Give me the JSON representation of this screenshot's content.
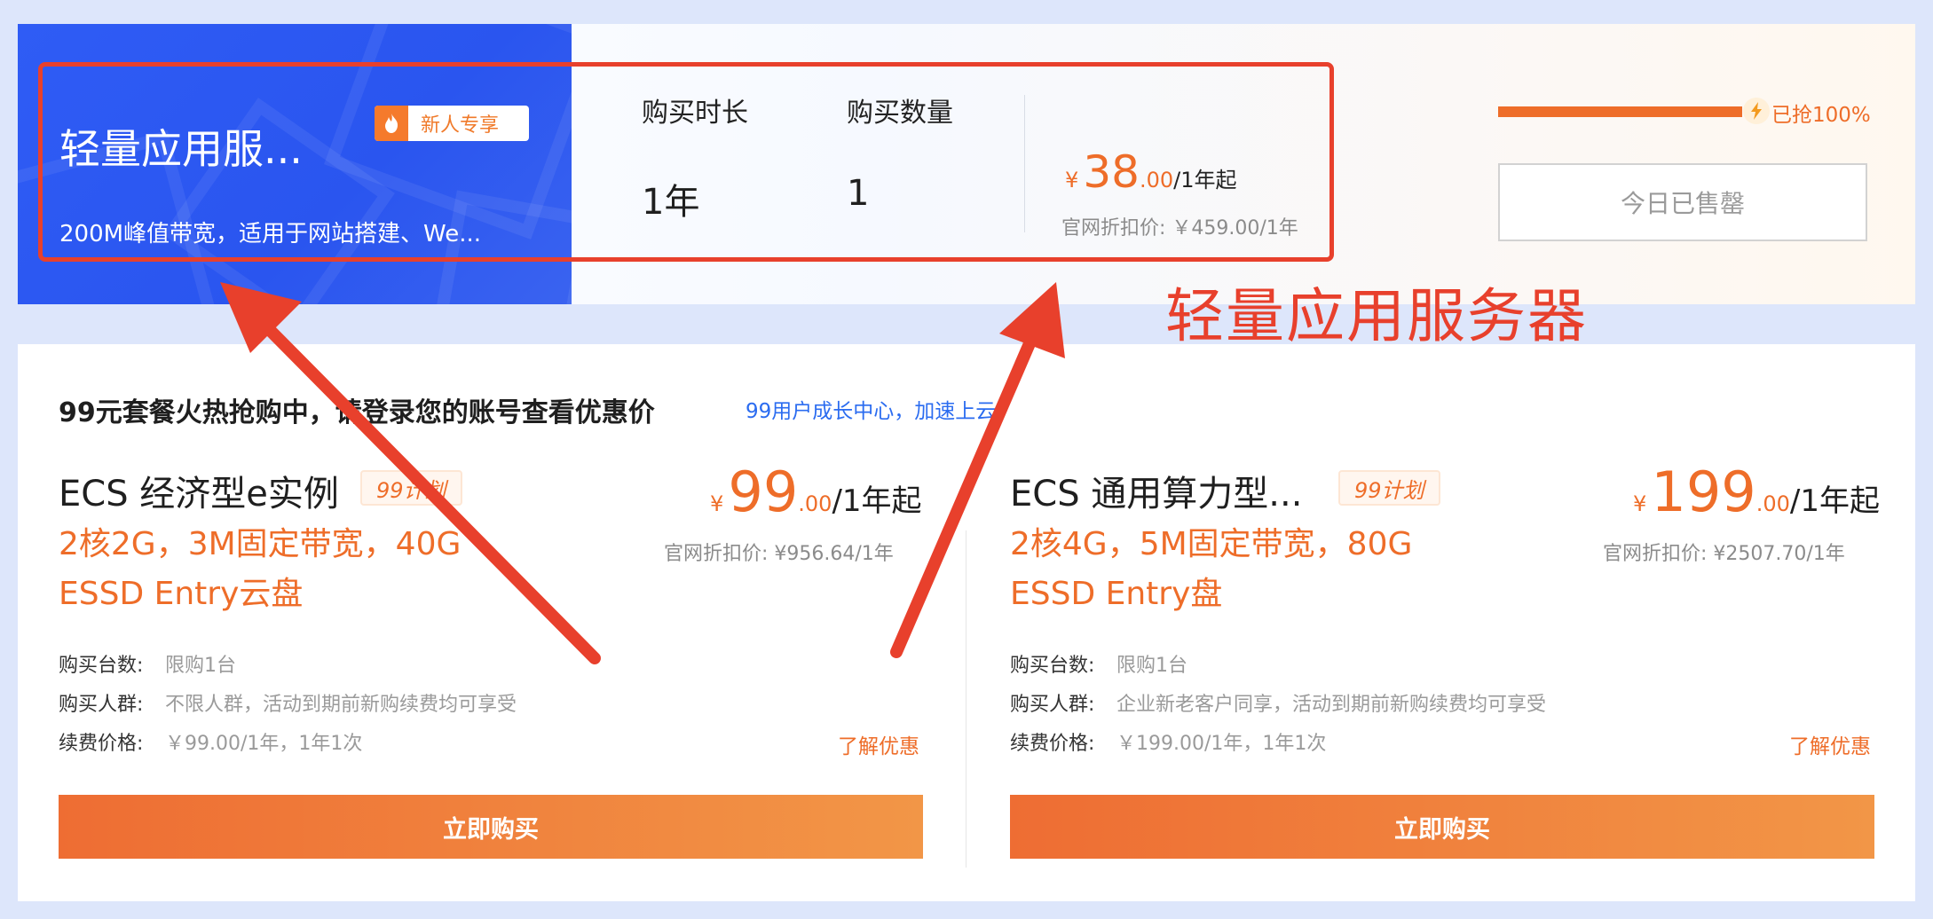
{
  "top_card": {
    "product_title": "轻量应用服...",
    "new_badge": "新人专享",
    "product_desc": "200M峰值带宽，适用于网站搭建、We...",
    "duration_label": "购买时长",
    "duration_value": "1年",
    "quantity_label": "购买数量",
    "quantity_value": "1",
    "price": {
      "currency": "¥",
      "integer": "38",
      "decimal": ".00",
      "unit": "/1年起"
    },
    "official_price": "官网折扣价: ￥459.00/1年",
    "progress_percent": 100,
    "progress_text": "已抢100%",
    "soldout_label": "今日已售罄"
  },
  "annotation": {
    "label": "轻量应用服务器",
    "color": "#e8402c"
  },
  "bottom_card": {
    "notice": "99元套餐火热抢购中，请登录您的账号查看优惠价",
    "notice_link": "99用户成长中心，加速上云",
    "products": [
      {
        "title": "ECS 经济型e实例",
        "plan_badge": "99计划",
        "spec_line1": "2核2G，3M固定带宽，40G",
        "spec_line2": "ESSD Entry云盘",
        "price": {
          "currency": "¥",
          "integer": "99",
          "decimal": ".00",
          "unit": "/1年起"
        },
        "official_price": "官网折扣价: ¥956.64/1年",
        "info": [
          {
            "label": "购买台数:",
            "value": "限购1台"
          },
          {
            "label": "购买人群:",
            "value": "不限人群，活动到期前新购续费均可享受"
          },
          {
            "label": "续费价格:",
            "value": "￥99.00/1年，1年1次"
          }
        ],
        "learn_more": "了解优惠",
        "buy_label": "立即购买"
      },
      {
        "title": "ECS 通用算力型...",
        "plan_badge": "99计划",
        "spec_line1": "2核4G，5M固定带宽，80G",
        "spec_line2": "ESSD Entry盘",
        "price": {
          "currency": "¥",
          "integer": "199",
          "decimal": ".00",
          "unit": "/1年起"
        },
        "official_price": "官网折扣价: ¥2507.70/1年",
        "info": [
          {
            "label": "购买台数:",
            "value": "限购1台"
          },
          {
            "label": "购买人群:",
            "value": "企业新老客户同享，活动到期前新购续费均可享受"
          },
          {
            "label": "续费价格:",
            "value": "￥199.00/1年，1年1次"
          }
        ],
        "learn_more": "了解优惠",
        "buy_label": "立即购买"
      }
    ]
  },
  "colors": {
    "accent": "#ee6d29",
    "brand_blue": "#2f5cf5",
    "link_blue": "#2b6cf0",
    "page_bg": "#dde6fb"
  },
  "icons": [
    "fire-icon",
    "lightning-icon",
    "annotation-arrow-icon"
  ]
}
